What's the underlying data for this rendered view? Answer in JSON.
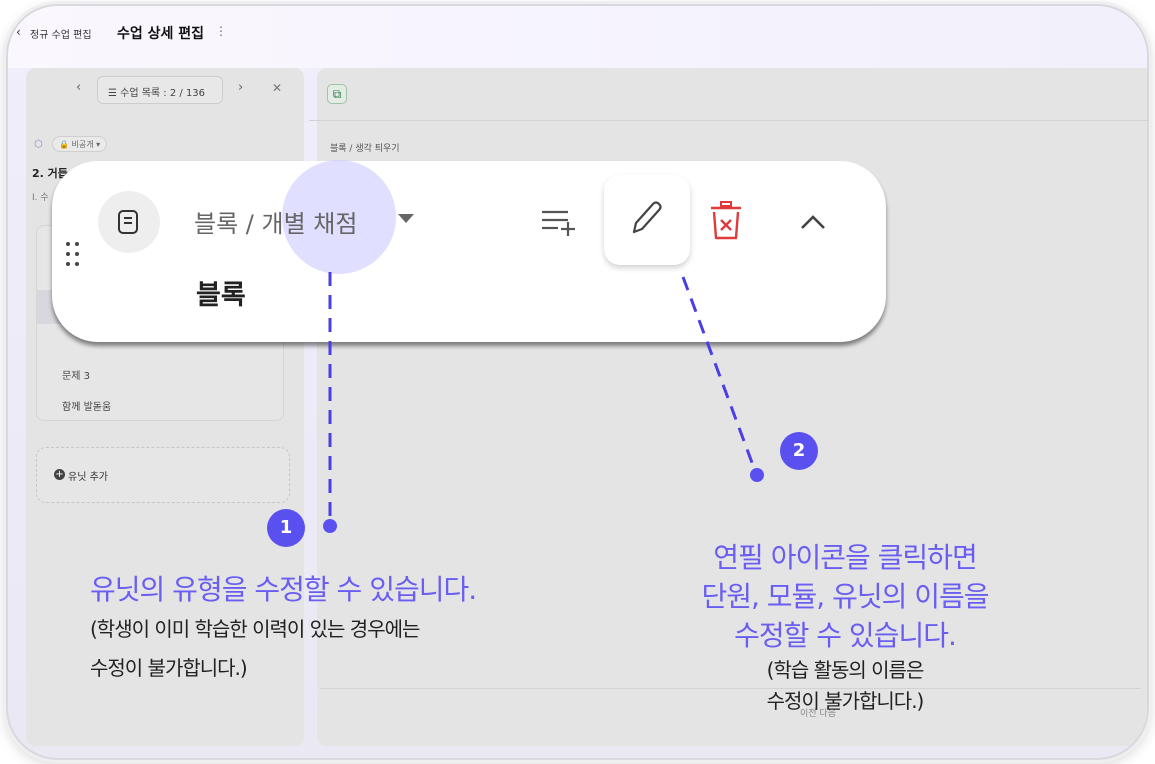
{
  "header": {
    "back_icon": "‹",
    "breadcrumb": "정규 수업 편집",
    "title": "수업 상세 편집",
    "more_icon": "⋮"
  },
  "left_panel": {
    "nav_prev": "‹",
    "nav_label": "☰ 수업 목록 : 2 / 136",
    "nav_next": "›",
    "nav_close": "✕",
    "cube_icon": "⬡",
    "visibility": "🔒 비공개 ▾",
    "unit_title": "2. 거듭",
    "unit_sub": "I. 수",
    "items": [
      "문제 3",
      "함께 발돋움"
    ],
    "add_unit_label": "유닛 추가"
  },
  "right_panel": {
    "breadcrumb": "블록 / 생각 틔우기",
    "pager": "이전   다음"
  },
  "popup": {
    "type_label": "블록 / 개별 채점",
    "block_name": "블록"
  },
  "markers": {
    "one": "1",
    "two": "2"
  },
  "caption1": {
    "main": "유닛의 유형을 수정할 수 있습니다.",
    "sub1": "(학생이 이미 학습한 이력이 있는 경우에는",
    "sub2": "수정이 불가합니다.)"
  },
  "caption2": {
    "line1": "연필 아이콘을 클릭하면",
    "line2": "단원, 모듈, 유닛의 이름을",
    "line3": "수정할 수 있습니다.",
    "sub1": "(학습 활동의 이름은",
    "sub2": "수정이 불가합니다.)"
  },
  "colors": {
    "accent": "#5a50f0",
    "caption_accent": "#6a5ef2",
    "delete_red": "#e03a3a"
  }
}
